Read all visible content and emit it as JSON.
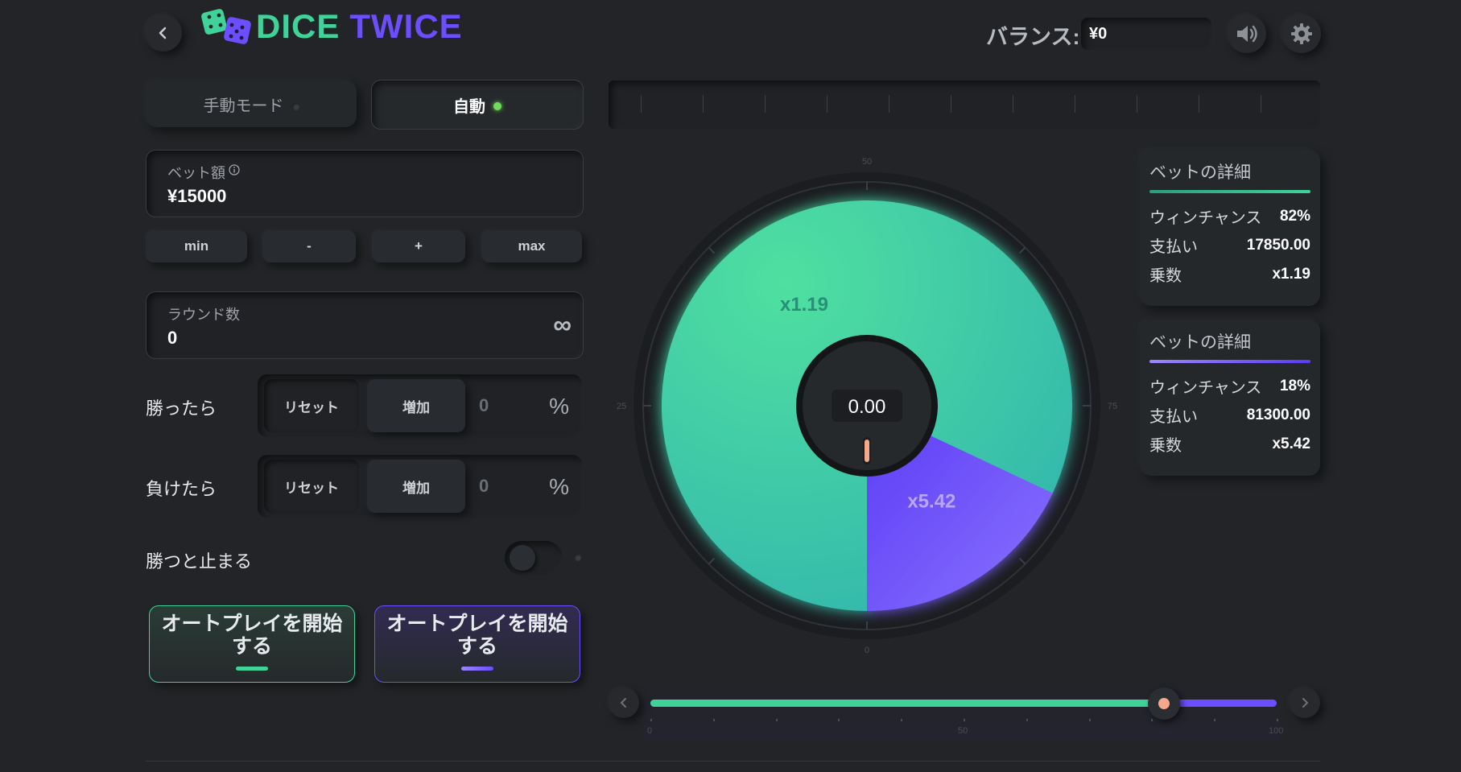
{
  "header": {
    "logo_part1": "DICE",
    "logo_part2": "TWICE",
    "balance_label": "バランス:",
    "balance_value": "¥0"
  },
  "mode_tabs": [
    {
      "label": "手動モード",
      "active": false
    },
    {
      "label": "自動",
      "active": true
    }
  ],
  "bet": {
    "label": "ベット額",
    "value": "¥15000",
    "buttons": [
      "min",
      "-",
      "+",
      "max"
    ]
  },
  "rounds": {
    "label": "ラウンド数",
    "value": "0",
    "infinity_symbol": "∞"
  },
  "on_win": {
    "label": "勝ったら",
    "reset_label": "リセット",
    "increase_label": "増加",
    "value": "0",
    "unit": "%"
  },
  "on_loss": {
    "label": "負けたら",
    "reset_label": "リセット",
    "increase_label": "増加",
    "value": "0",
    "unit": "%"
  },
  "stop_on_win": {
    "label": "勝つと止まる",
    "enabled": false
  },
  "autoplay_buttons": [
    {
      "label": "オートプレイを開始する",
      "color": "#3ed598"
    },
    {
      "label": "オートプレイを開始する",
      "color": "#6c4dff"
    }
  ],
  "wheel": {
    "center_value": "0.00",
    "scale_labels": [
      "50",
      "25",
      "75",
      "0"
    ],
    "segments": [
      {
        "label": "x1.19",
        "percent": 82,
        "color": "#3fd39a"
      },
      {
        "label": "x5.42",
        "percent": 18,
        "color": "#6c4dff"
      }
    ]
  },
  "bet_details": [
    {
      "title": "ベットの詳細",
      "accent": "#3fd39a",
      "win_chance_label": "ウィンチャンス",
      "win_chance": "82%",
      "payout_label": "支払い",
      "payout": "17850.00",
      "multiplier_label": "乗数",
      "multiplier": "x1.19"
    },
    {
      "title": "ベットの詳細",
      "accent": "#6c4dff",
      "win_chance_label": "ウィンチャンス",
      "win_chance": "18%",
      "payout_label": "支払い",
      "payout": "81300.00",
      "multiplier_label": "乗数",
      "multiplier": "x5.42"
    }
  ],
  "slider": {
    "value": 82,
    "min_label": "0",
    "mid_label": "50",
    "max_label": "100"
  },
  "colors": {
    "green": "#3fd39a",
    "purple": "#6c4dff",
    "background": "#222427",
    "thumb": "#f5a98a"
  },
  "icons": [
    "back-icon",
    "dice-logo-icon",
    "sound-icon",
    "gear-icon",
    "info-icon",
    "infinity-icon",
    "chevron-left-icon",
    "chevron-right-icon"
  ]
}
